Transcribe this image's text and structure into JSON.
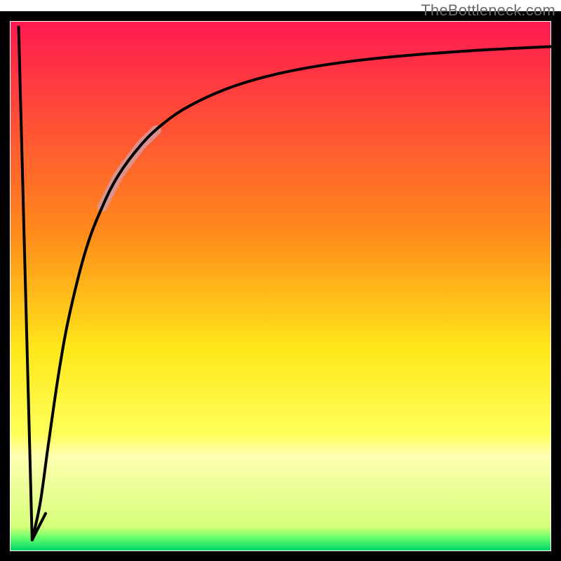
{
  "watermark": "TheBottleneck.com",
  "chart_data": {
    "type": "line",
    "title": "",
    "xlabel": "",
    "ylabel": "",
    "xlim": [
      0,
      100
    ],
    "ylim": [
      0,
      100
    ],
    "background_gradient": {
      "stops": [
        {
          "offset": 0.0,
          "color": "#ff1a50"
        },
        {
          "offset": 0.4,
          "color": "#ff8a1a"
        },
        {
          "offset": 0.62,
          "color": "#ffe81a"
        },
        {
          "offset": 0.78,
          "color": "#ffff5a"
        },
        {
          "offset": 0.82,
          "color": "#ffffb0"
        },
        {
          "offset": 0.955,
          "color": "#d6ff7a"
        },
        {
          "offset": 0.975,
          "color": "#6aff6a"
        },
        {
          "offset": 1.0,
          "color": "#00d66a"
        }
      ]
    },
    "series": [
      {
        "name": "left-spike",
        "x": [
          1.5,
          4.0,
          6.5
        ],
        "y": [
          99.0,
          2.0,
          7.0
        ]
      },
      {
        "name": "main-curve",
        "x": [
          4.0,
          5.5,
          7.0,
          9.0,
          11.0,
          14.0,
          17.0,
          20.0,
          24.0,
          28.0,
          33.0,
          40.0,
          48.0,
          58.0,
          70.0,
          85.0,
          100.0
        ],
        "y": [
          2.0,
          9.0,
          20.0,
          34.0,
          45.0,
          57.0,
          65.0,
          71.0,
          76.5,
          80.5,
          84.0,
          87.3,
          89.8,
          91.8,
          93.3,
          94.5,
          95.3
        ]
      }
    ],
    "highlight_segment": {
      "on_series": "main-curve",
      "x_start": 17.0,
      "x_end": 27.0,
      "color": "#d59aa0",
      "width": 14
    },
    "frame_color": "#000000",
    "frame_width": 14
  }
}
